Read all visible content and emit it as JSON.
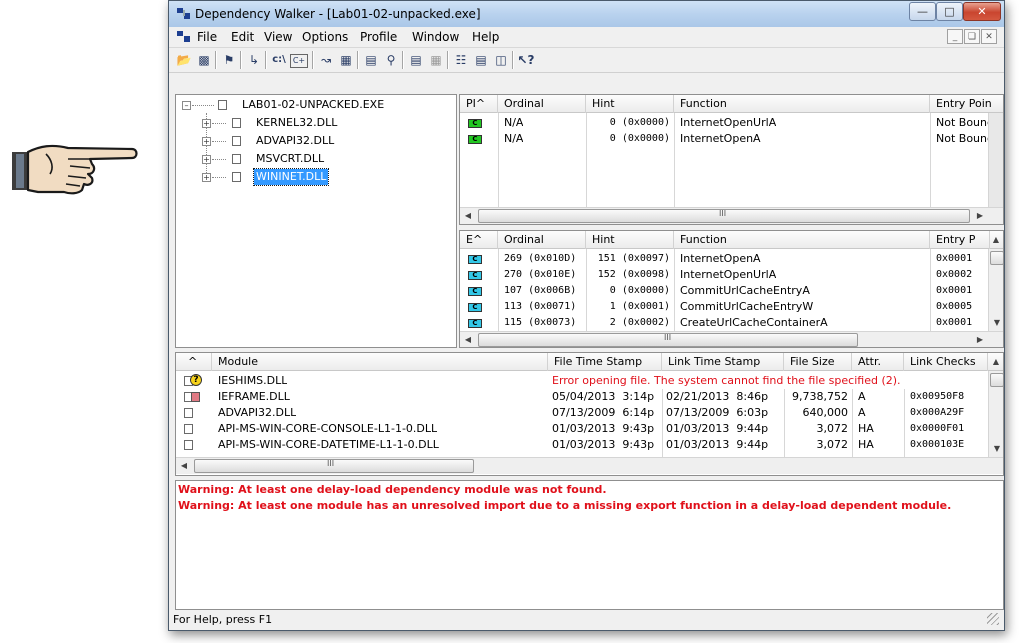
{
  "window": {
    "title": "Dependency Walker - [Lab01-02-unpacked.exe]",
    "caption_buttons": [
      "minimize",
      "maximize",
      "close"
    ]
  },
  "menu": [
    "File",
    "Edit",
    "View",
    "Options",
    "Profile",
    "Window",
    "Help"
  ],
  "toolbar_icons": [
    "open-icon",
    "save-icon",
    "copy-icon",
    "highlight-icon",
    "full-paths-icon",
    "undecorate-cpp-icon",
    "auto-expand-icon",
    "view-full-paths-icon",
    "system-info-icon",
    "find-icon",
    "properties-icon",
    "expand-all-icon",
    "collapse-all-icon",
    "split-icon",
    "help-icon"
  ],
  "tree": {
    "root": "LAB01-02-UNPACKED.EXE",
    "children": [
      "KERNEL32.DLL",
      "ADVAPI32.DLL",
      "MSVCRT.DLL",
      "WININET.DLL"
    ],
    "selected": "WININET.DLL"
  },
  "imports": {
    "columns": [
      "PI^",
      "Ordinal",
      "Hint",
      "Function",
      "Entry Poin"
    ],
    "rows": [
      {
        "badge": "C",
        "ordinal": "N/A",
        "hint": "0 (0x0000)",
        "function": "InternetOpenUrlA",
        "entry": "Not Bound"
      },
      {
        "badge": "C",
        "ordinal": "N/A",
        "hint": "0 (0x0000)",
        "function": "InternetOpenA",
        "entry": "Not Bound"
      }
    ]
  },
  "exports": {
    "columns": [
      "E^",
      "Ordinal",
      "Hint",
      "Function",
      "Entry P"
    ],
    "rows": [
      {
        "badge": "C",
        "ordinal": "269 (0x010D)",
        "hint": "151 (0x0097)",
        "function": "InternetOpenA",
        "entry": "0x0001"
      },
      {
        "badge": "C",
        "ordinal": "270 (0x010E)",
        "hint": "152 (0x0098)",
        "function": "InternetOpenUrlA",
        "entry": "0x0002"
      },
      {
        "badge": "C",
        "ordinal": "107 (0x006B)",
        "hint": "0 (0x0000)",
        "function": "CommitUrlCacheEntryA",
        "entry": "0x0001"
      },
      {
        "badge": "C",
        "ordinal": "113 (0x0071)",
        "hint": "1 (0x0001)",
        "function": "CommitUrlCacheEntryW",
        "entry": "0x0005"
      },
      {
        "badge": "C",
        "ordinal": "115 (0x0073)",
        "hint": "2 (0x0002)",
        "function": "CreateUrlCacheContainerA",
        "entry": "0x0001"
      }
    ]
  },
  "modules": {
    "columns": [
      "^",
      "Module",
      "File Time Stamp",
      "Link Time Stamp",
      "File Size",
      "Attr.",
      "Link Checks"
    ],
    "rows": [
      {
        "module": "IESHIMS.DLL",
        "error": "Error opening file. The system cannot find the file specified (2).",
        "file_ts": "",
        "link_ts": "",
        "size": "",
        "attr": "",
        "checks": ""
      },
      {
        "module": "IEFRAME.DLL",
        "error": "",
        "file_ts": "05/04/2013  3:14p",
        "link_ts": "02/21/2013  8:46p",
        "size": "9,738,752",
        "attr": "A",
        "checks": "0x00950F8"
      },
      {
        "module": "ADVAPI32.DLL",
        "error": "",
        "file_ts": "07/13/2009  6:14p",
        "link_ts": "07/13/2009  6:03p",
        "size": "640,000",
        "attr": "A",
        "checks": "0x000A29F"
      },
      {
        "module": "API-MS-WIN-CORE-CONSOLE-L1-1-0.DLL",
        "error": "",
        "file_ts": "01/03/2013  9:43p",
        "link_ts": "01/03/2013  9:44p",
        "size": "3,072",
        "attr": "HA",
        "checks": "0x0000F01"
      },
      {
        "module": "API-MS-WIN-CORE-DATETIME-L1-1-0.DLL",
        "error": "",
        "file_ts": "01/03/2013  9:43p",
        "link_ts": "01/03/2013  9:44p",
        "size": "3,072",
        "attr": "HA",
        "checks": "0x000103E"
      }
    ]
  },
  "log": [
    "Warning: At least one delay-load dependency module was not found.",
    "Warning: At least one module has an unresolved import due to a missing export function in a delay-load dependent module."
  ],
  "status": "For Help, press F1",
  "colors": {
    "error": "#e0101a",
    "selection": "#3399ff",
    "badge_import": "#22c722",
    "badge_export": "#33c8e8"
  }
}
